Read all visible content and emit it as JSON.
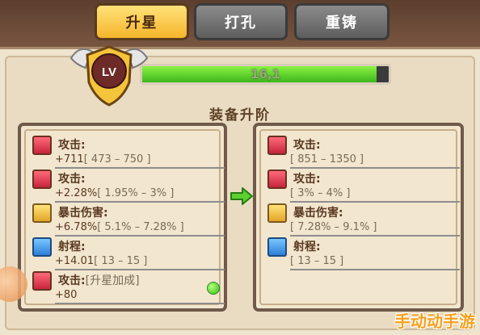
{
  "tabs": [
    {
      "label": "升星",
      "active": true
    },
    {
      "label": "打孔",
      "active": false
    },
    {
      "label": "重铸",
      "active": false
    }
  ],
  "level_badge": {
    "text": "LV"
  },
  "progress": {
    "text": "16,1",
    "fraction": 0.95
  },
  "section_title": "装备升阶",
  "left_stats": [
    {
      "icon": "attack-icon",
      "label": "攻击:",
      "value": "+711",
      "range": "[ 473 – 750 ]"
    },
    {
      "icon": "attack-icon",
      "label": "攻击:",
      "value": "+2.28%",
      "range": "[ 1.95% – 3% ]"
    },
    {
      "icon": "crit-damage-icon",
      "label": "暴击伤害:",
      "value": "+6.78%",
      "range": "[ 5.1% – 7.28% ]"
    },
    {
      "icon": "range-icon",
      "label": "射程:",
      "value": "+14.01",
      "range": "[ 13 – 15 ]"
    },
    {
      "icon": "attack-icon",
      "label": "攻击:",
      "value": "+80",
      "range": "[升星加成]"
    }
  ],
  "right_stats": [
    {
      "icon": "attack-icon",
      "label": "攻击:",
      "range": "[ 851 – 1350 ]"
    },
    {
      "icon": "attack-icon",
      "label": "攻击:",
      "range": "[ 3% – 4% ]"
    },
    {
      "icon": "crit-damage-icon",
      "label": "暴击伤害:",
      "range": "[ 7.28% – 9.1% ]"
    },
    {
      "icon": "range-icon",
      "label": "射程:",
      "range": "[ 13 – 15 ]"
    }
  ],
  "watermark": "手动动手游",
  "colors": {
    "tab_active": "#f5b52b",
    "tab_inactive": "#6d6d6d",
    "progress_fill": "#5ad12c",
    "panel_bg": "#efe4ce",
    "stat_box_border": "#6f5a4a"
  }
}
